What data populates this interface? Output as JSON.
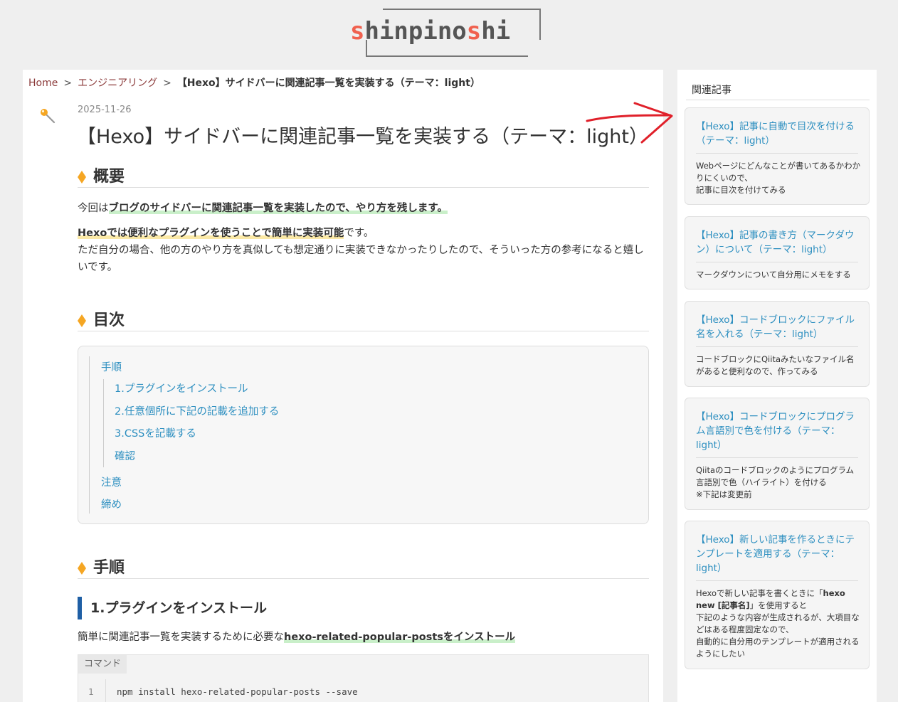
{
  "site": {
    "logo_prefix_hl": "s",
    "logo_mid": "hinpino",
    "logo_suffix_hl": "s",
    "logo_end": "hi"
  },
  "breadcrumb": {
    "home": "Home",
    "sep1": ">",
    "category": "エンジニアリング",
    "sep2": ">",
    "current": "【Hexo】サイドバーに関連記事一覧を実装する（テーマ：light）"
  },
  "post": {
    "date": "2025-11-26",
    "title": "【Hexo】サイドバーに関連記事一覧を実装する（テーマ：light）"
  },
  "sections": {
    "overview": {
      "heading": "概要",
      "p1_plain": "今回は",
      "p1_mark": "ブログのサイドバーに関連記事一覧を実装したので、やり方を残します。",
      "p2_mark": "Hexoでは便利なプラグインを使うことで簡単に実装可能",
      "p2_plain": "です。",
      "p3": "ただ自分の場合、他の方のやり方を真似しても想定通りに実装できなかったりしたので、そういった方の参考になると嬉しいです。"
    },
    "toc": {
      "heading": "目次",
      "items": [
        "手順",
        "1.プラグインをインストール",
        "2.任意個所に下記の記載を追加する",
        "3.CSSを記載する",
        "確認",
        "注意",
        "締め"
      ]
    },
    "steps": {
      "heading": "手順",
      "sub1": "1.プラグインをインストール",
      "sub1_plain": "簡単に関連記事一覧を実装するために必要な",
      "sub1_mark": "hexo-related-popular-postsをインストール",
      "code_label": "コマンド",
      "code_line_no": "1",
      "code": "npm install hexo-related-popular-posts --save"
    }
  },
  "sidebar": {
    "title": "関連記事",
    "related": [
      {
        "title": "【Hexo】記事に自動で目次を付ける（テーマ：light）",
        "desc_lines": [
          "Webページにどんなことが書いてあるかわかりにくいので、",
          "記事に目次を付けてみる"
        ]
      },
      {
        "title": "【Hexo】記事の書き方（マークダウン）について（テーマ：light）",
        "desc_lines": [
          "マークダウンについて自分用にメモをする"
        ]
      },
      {
        "title": "【Hexo】コードブロックにファイル名を入れる（テーマ：light）",
        "desc_lines": [
          "コードブロックにQiitaみたいなファイル名があると便利なので、作ってみる"
        ]
      },
      {
        "title": "【Hexo】コードブロックにプログラム言語別で色を付ける（テーマ：light）",
        "desc_lines": [
          "Qiitaのコードブロックのようにプログラム言語別で色（ハイライト）を付ける",
          "※下記は変更前"
        ]
      },
      {
        "title": "【Hexo】新しい記事を作るときにテンプレートを適用する（テーマ：light）",
        "desc_a": "Hexoで新しい記事を書くときに「",
        "desc_code": "hexo new [記事名]",
        "desc_b": "」を使用すると",
        "desc_lines": [
          "下記のような内容が生成されるが、大項目などはある程度固定なので、",
          "自動的に自分用のテンプレートが適用されるようにしたい"
        ]
      }
    ]
  },
  "colors": {
    "link": "#2d8fc0",
    "accent_diamond": "#f5a623",
    "h3_bar": "#1f5fa5",
    "annotation_arrow": "#e0202a",
    "logo_highlight": "#f0604e"
  }
}
